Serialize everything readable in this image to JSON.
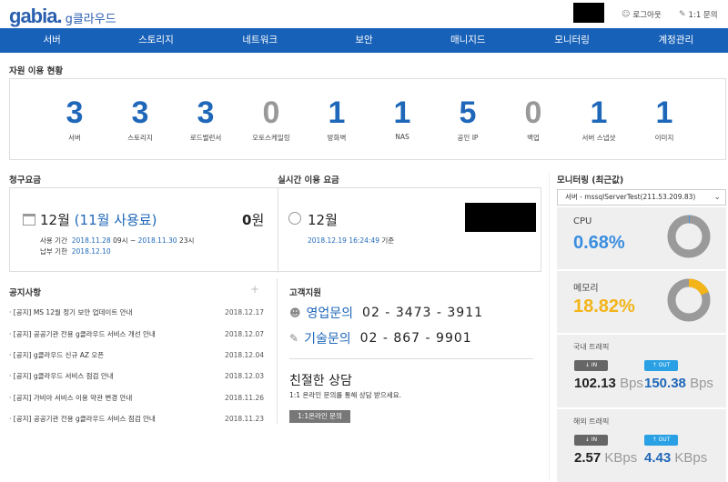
{
  "header": {
    "logo_brand": "gabia.",
    "logo_sub": "g클라우드",
    "logout": "로그아웃",
    "inquiry": "1:1 문의"
  },
  "nav": [
    "서버",
    "스토리지",
    "네트워크",
    "보안",
    "매니지드",
    "모니터링",
    "계정관리"
  ],
  "resources": {
    "title": "자원 이용 현황",
    "items": [
      {
        "count": "3",
        "label": "서버"
      },
      {
        "count": "3",
        "label": "스토리지"
      },
      {
        "count": "3",
        "label": "로드밸런서"
      },
      {
        "count": "0",
        "label": "오토스케일링"
      },
      {
        "count": "1",
        "label": "방화벽"
      },
      {
        "count": "1",
        "label": "NAS"
      },
      {
        "count": "5",
        "label": "공인 IP"
      },
      {
        "count": "0",
        "label": "백업"
      },
      {
        "count": "1",
        "label": "서버 스냅샷"
      },
      {
        "count": "1",
        "label": "이미지"
      }
    ]
  },
  "billing": {
    "title": "청구요금",
    "month": "12월",
    "usage_month": "(11월 사용료)",
    "amount": "0",
    "amount_unit": "원",
    "period_label": "사용 기간",
    "period_start_date": "2018.11.28",
    "period_start_time": "09시",
    "period_sep": "~",
    "period_end_date": "2018.11.30",
    "period_end_time": "23시",
    "due_label": "납부 기한",
    "due_date": "2018.12.10"
  },
  "realtime": {
    "title": "실시간 이용 요금",
    "month": "12월",
    "timestamp": "2018.12.19 16:24:49",
    "basis": "기준"
  },
  "notices": {
    "title": "공지사항",
    "more": "+",
    "items": [
      {
        "title": "[공지] MS 12월 정기 보안 업데이트 안내",
        "date": "2018.12.17"
      },
      {
        "title": "[공지] 공공기관 전용 g클라우드 서비스 개선 안내",
        "date": "2018.12.07"
      },
      {
        "title": "[공지] g클라우드 신규 AZ 오픈",
        "date": "2018.12.04"
      },
      {
        "title": "[공지] g클라우드 서비스 점검 안내",
        "date": "2018.12.03"
      },
      {
        "title": "[공지] 가비아 서비스 이용 약관 변경 안내",
        "date": "2018.11.26"
      },
      {
        "title": "[공지] 공공기관 전용 g클라우드 서비스 점검 안내",
        "date": "2018.11.23"
      }
    ]
  },
  "support": {
    "title": "고객지원",
    "sales_label": "영업문의",
    "sales_phone": "02 - 3473 - 3911",
    "tech_label": "기술문의",
    "tech_phone": "02 - 867 - 9901",
    "consult_title": "친절한 상담",
    "consult_desc": "1:1 온라인 문의를 통해 상담 받으세요.",
    "consult_button": "1:1온라인 문의"
  },
  "monitoring": {
    "title": "모니터링 (최근값)",
    "selected_server": "서버 - mssqlServerTest(211.53.209.83)",
    "cpu_label": "CPU",
    "cpu_value": "0.68%",
    "cpu_percent": 0.68,
    "mem_label": "메모리",
    "mem_value": "18.82%",
    "mem_percent": 18.82,
    "domestic_label": "국내 트래픽",
    "domestic_in": "102.13",
    "domestic_in_unit": "Bps",
    "domestic_out": "150.38",
    "domestic_out_unit": "Bps",
    "overseas_label": "해외 트래픽",
    "overseas_in": "2.57",
    "overseas_in_unit": "KBps",
    "overseas_out": "4.43",
    "overseas_out_unit": "KBps",
    "in_label": "IN",
    "out_label": "OUT"
  },
  "colors": {
    "brand_blue": "#1761b8",
    "cpu_blue": "#3a8ee0",
    "mem_yellow": "#f2b418",
    "donut_track": "#9a9a9a"
  }
}
